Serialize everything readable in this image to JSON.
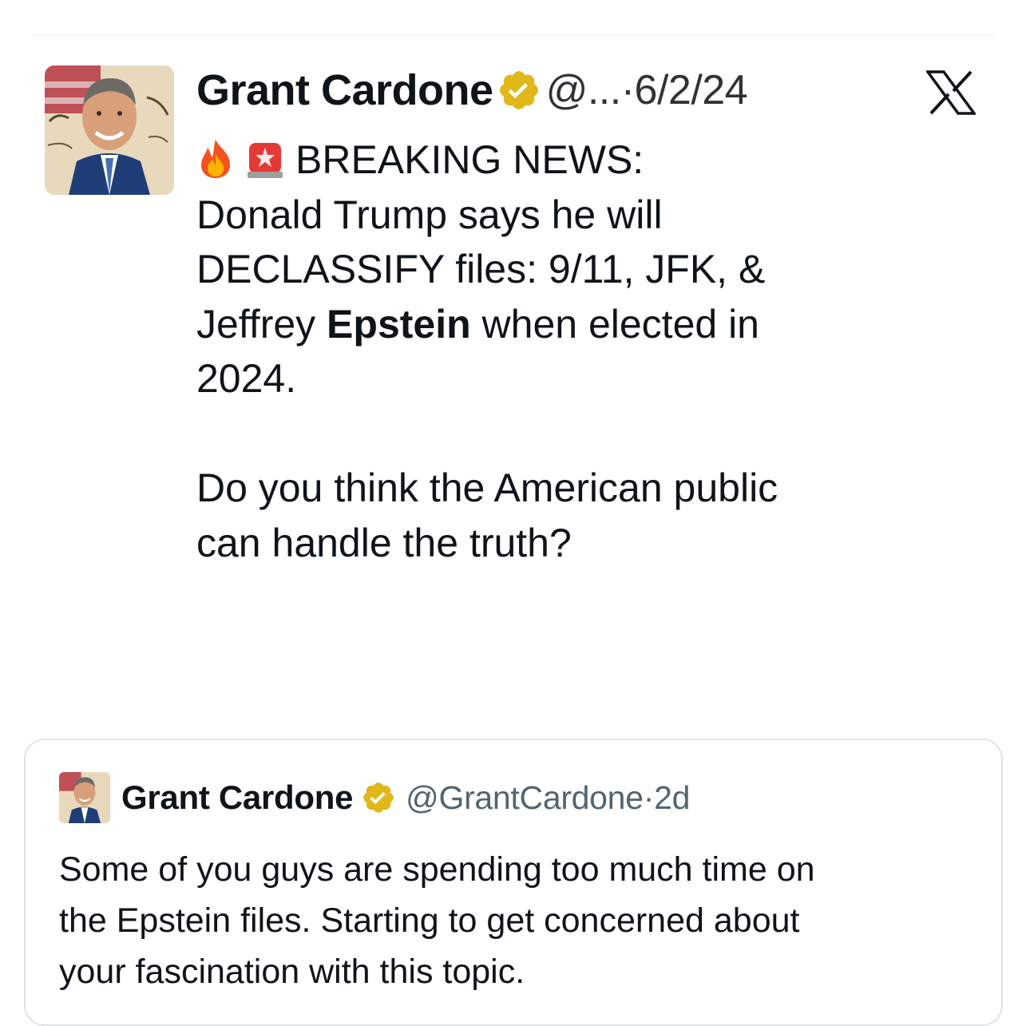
{
  "tweet": {
    "author_name": "Grant Cardone",
    "handle_short": "@...",
    "separator": "·",
    "date": "6/2/24",
    "icons": {
      "verified": "verified-badge-icon",
      "platform": "x-logo-icon",
      "fire": "fire-emoji-icon",
      "siren": "siren-emoji-icon"
    },
    "body": {
      "line1": "BREAKING NEWS:",
      "line2": "Donald Trump says he will",
      "line3": "DECLASSIFY files:  9/11, JFK, &",
      "line4_pre": "Jeffrey ",
      "line4_bold": "Epstein",
      "line4_post": " when elected in",
      "line5": "2024.",
      "line6": "Do you think the American public",
      "line7": "can handle the truth?"
    }
  },
  "quoted_tweet": {
    "author_name": "Grant Cardone",
    "handle": "@GrantCardone",
    "separator": "·",
    "age": "2d",
    "body": {
      "line1": "Some of you guys are spending too much time on",
      "line2": "the Epstein files.  Starting to get concerned about",
      "line3": "your fascination with this topic."
    }
  },
  "colors": {
    "text": "#0f1419",
    "secondary": "#536471",
    "verified_gold": "#e2b719",
    "border": "#dfe3e6"
  }
}
